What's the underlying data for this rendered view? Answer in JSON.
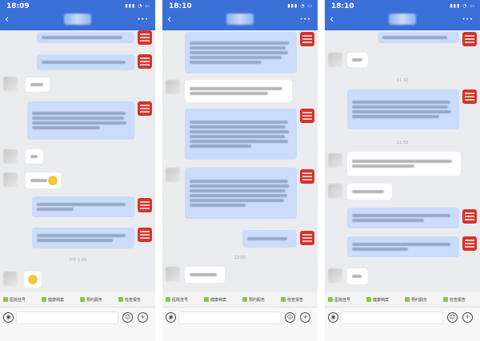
{
  "panels": [
    {
      "time": "18:09",
      "quick_replies": [
        "医院挂号",
        "健康档案",
        "预约服务",
        "检查报告"
      ],
      "timestamp": "下午 1:00",
      "message_text_status": "blurred"
    },
    {
      "time": "18:10",
      "quick_replies": [
        "医院挂号",
        "健康档案",
        "预约服务",
        "检查报告"
      ],
      "timestamp": "12:56",
      "message_text_status": "blurred"
    },
    {
      "time": "18:10",
      "quick_replies": [
        "医院挂号",
        "健康档案",
        "预约服务",
        "检查报告"
      ],
      "timestamps": [
        "11:42",
        "11:53"
      ],
      "message_text_status": "blurred"
    }
  ],
  "icons": {
    "back": "chevron-left-icon",
    "more": "more-dots-icon",
    "voice": "voice-icon",
    "emoji": "emoji-icon",
    "plus": "plus-icon",
    "quick_reply": "green-tag-icon"
  }
}
